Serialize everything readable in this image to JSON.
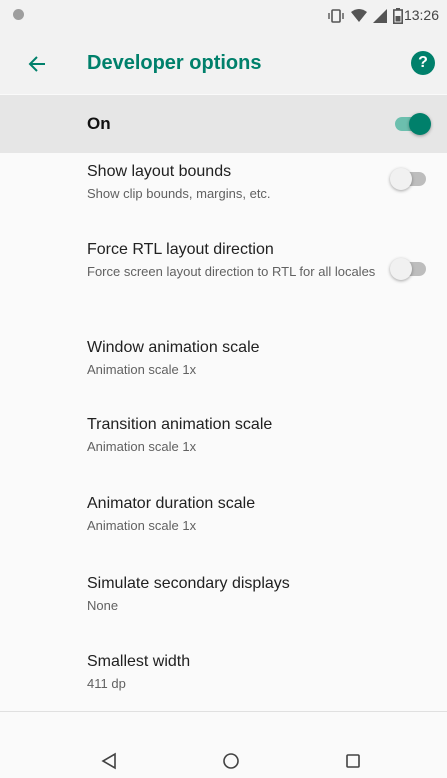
{
  "status_bar": {
    "time": "13:26"
  },
  "app_bar": {
    "title": "Developer options",
    "help_icon_glyph": "?",
    "accent": "#00806b"
  },
  "master_switch": {
    "label": "On",
    "enabled": true
  },
  "preferences": [
    {
      "title": "Show layout bounds",
      "summary": "Show clip bounds, margins, etc.",
      "has_switch": true,
      "enabled": false
    },
    {
      "title": "Force RTL layout direction",
      "summary": "Force screen layout direction to RTL for all locales",
      "has_switch": true,
      "enabled": false
    },
    {
      "title": "Window animation scale",
      "summary": "Animation scale 1x"
    },
    {
      "title": "Transition animation scale",
      "summary": "Animation scale 1x"
    },
    {
      "title": "Animator duration scale",
      "summary": "Animation scale 1x"
    },
    {
      "title": "Simulate secondary displays",
      "summary": "None"
    },
    {
      "title": "Smallest width",
      "summary": "411 dp"
    }
  ],
  "icons": {
    "back": "arrow-left-icon",
    "help": "help-circle-icon",
    "nav_back": "triangle-back-icon",
    "nav_home": "circle-home-icon",
    "nav_recents": "square-recents-icon"
  }
}
